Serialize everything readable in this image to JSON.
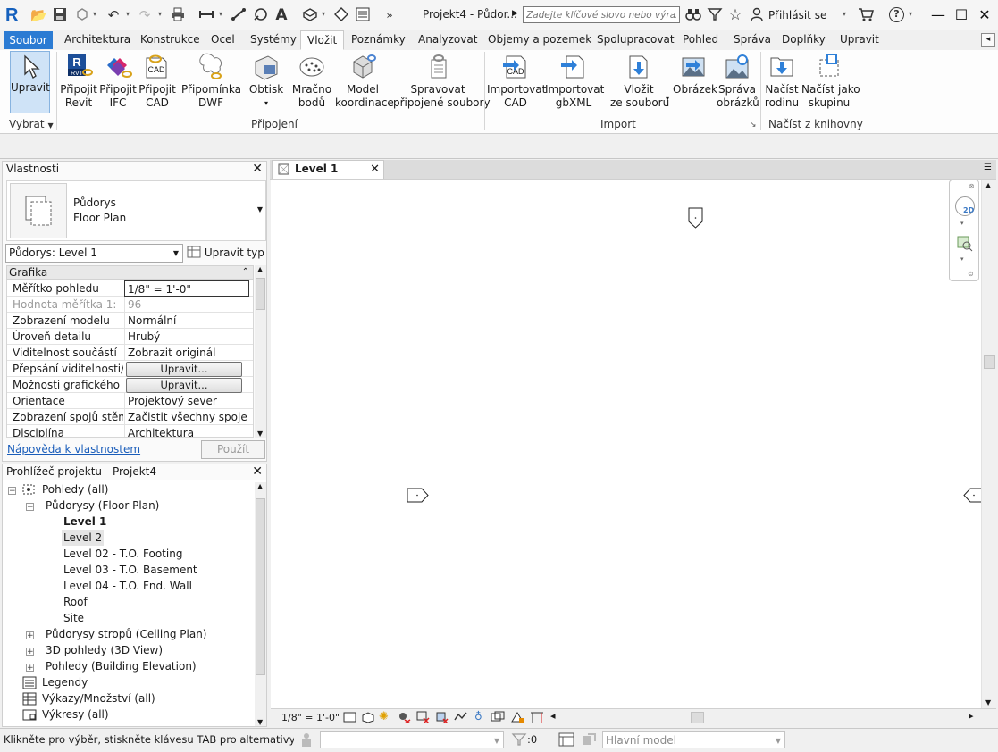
{
  "titlebar": {
    "app_logo": "R",
    "document_title": "Projekt4 - Půdor...",
    "search_placeholder": "Zadejte klíčové slovo nebo výraz.",
    "signin_label": "Přihlásit se",
    "help_label": "?"
  },
  "tabs": {
    "file": "Soubor",
    "items": [
      "Architektura",
      "Konstrukce",
      "Ocel",
      "Systémy",
      "Vložit",
      "Poznámky",
      "Analyzovat",
      "Objemy a pozemek",
      "Spolupracovat",
      "Pohled",
      "Správa",
      "Doplňky",
      "Upravit"
    ],
    "active": "Vložit",
    "scroll_glyph": "◂"
  },
  "ribbon": {
    "select_button": "Upravit",
    "select_group": "Vybrat",
    "buttons": {
      "link_revit_1": "Připojit",
      "link_revit_2": "Revit",
      "link_ifc_1": "Připojit",
      "link_ifc_2": "IFC",
      "link_cad_1": "Připojit",
      "link_cad_2": "CAD",
      "dwf_1": "Připomínka",
      "dwf_2": "DWF",
      "decal_1": "Obtisk",
      "cloud_1": "Mračno",
      "cloud_2": "bodů",
      "coord_1": "Model",
      "coord_2": "koordinace",
      "manage_1": "Spravovat",
      "manage_2": "připojené soubory",
      "import_cad_1": "Importovat",
      "import_cad_2": "CAD",
      "import_gbxml_1": "Importovat",
      "import_gbxml_2": "gbXML",
      "insert_file_1": "Vložit",
      "insert_file_2": "ze souboru",
      "image_1": "Obrázek",
      "manage_images_1": "Správa",
      "manage_images_2": "obrázků",
      "load_family_1": "Načíst",
      "load_family_2": "rodinu",
      "load_group_1": "Načíst jako",
      "load_group_2": "skupinu"
    },
    "groups": {
      "link": "Připojení",
      "import": "Import",
      "library": "Načíst z knihovny"
    },
    "icon_texts": {
      "rvt": "RVT",
      "cad": "CAD"
    }
  },
  "properties": {
    "title": "Vlastnosti",
    "type_line1": "Půdorys",
    "type_line2": "Floor Plan",
    "instance_filter": "Půdorys: Level 1",
    "edit_type": "Upravit typ",
    "section": "Grafika",
    "rows": [
      {
        "name": "Měřítko pohledu",
        "value": "1/8\" = 1'-0\""
      },
      {
        "name": "Hodnota měřítka    1:",
        "value": "96"
      },
      {
        "name": "Zobrazení modelu",
        "value": "Normální"
      },
      {
        "name": "Úroveň detailu",
        "value": "Hrubý"
      },
      {
        "name": "Viditelnost součástí",
        "value": "Zobrazit originál"
      },
      {
        "name": "Přepsání viditelnosti/...",
        "value": "Upravit..."
      },
      {
        "name": "Možnosti grafického ...",
        "value": "Upravit..."
      },
      {
        "name": "Orientace",
        "value": "Projektový sever"
      },
      {
        "name": "Zobrazení spojů stěn",
        "value": "Začistit všechny spoje ..."
      },
      {
        "name": "Disciplína",
        "value": "Architektura"
      }
    ],
    "help_link": "Nápověda k vlastnostem",
    "apply_button": "Použít"
  },
  "browser": {
    "title": "Prohlížeč projektu - Projekt4",
    "nodes": {
      "views": "Pohledy (all)",
      "floor_plans": "Půdorysy (Floor Plan)",
      "level1": "Level 1",
      "level2": "Level 2",
      "level02": "Level 02 - T.O. Footing",
      "level03": "Level 03 - T.O. Basement",
      "level04": "Level 04 - T.O. Fnd. Wall",
      "roof": "Roof",
      "site": "Site",
      "ceiling": "Půdorysy stropů (Ceiling Plan)",
      "views3d": "3D pohledy (3D View)",
      "elevations": "Pohledy (Building Elevation)",
      "legends": "Legendy",
      "schedules": "Výkazy/Množství (all)",
      "sheets": "Výkresy (all)"
    }
  },
  "view": {
    "tab_label": "Level 1",
    "scale": "1/8\" = 1'-0\"",
    "navbar_2d": "2D"
  },
  "status": {
    "message": "Klikněte pro výběr, stiskněte klávesu TAB pro alternativy, CTRL",
    "filter_count": ":0",
    "main_model": "Hlavní model"
  },
  "colors": {
    "accent": "#2b7bd3",
    "selection": "#cfe3f7",
    "link": "#1a5dba"
  }
}
